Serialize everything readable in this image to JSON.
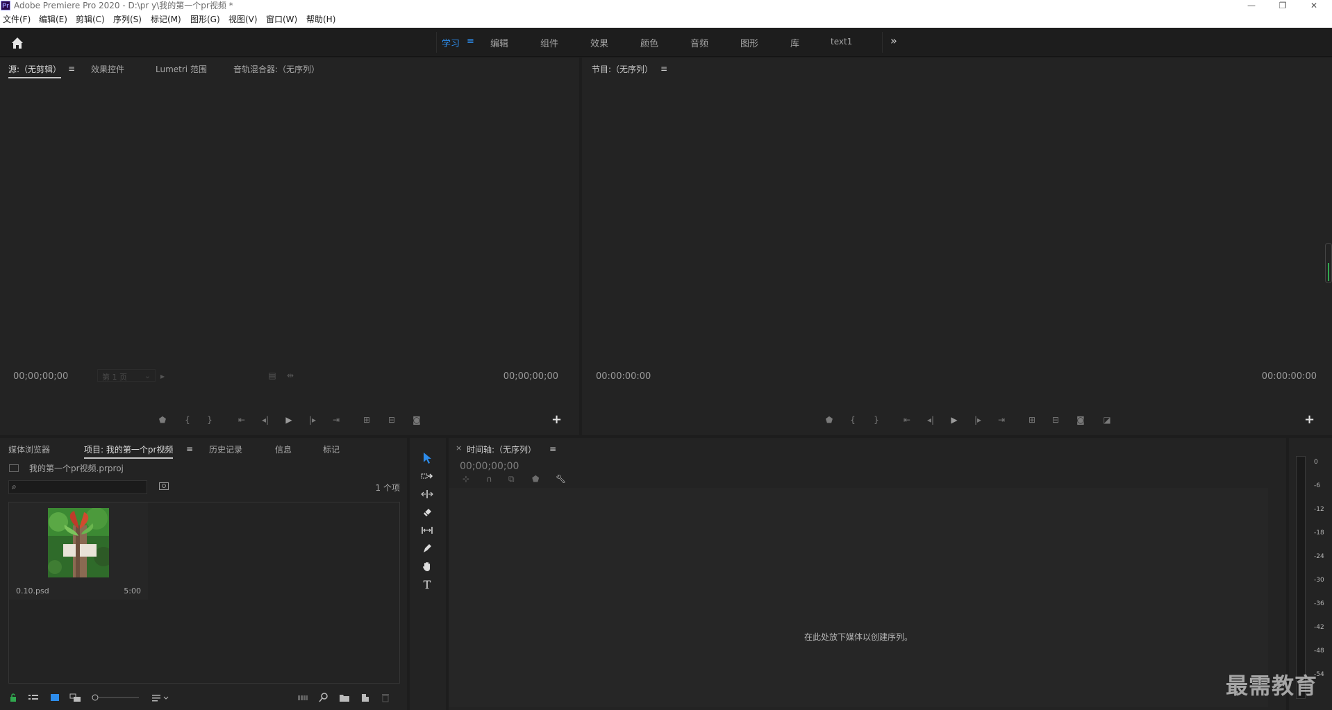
{
  "window": {
    "title": "Adobe Premiere Pro 2020 - D:\\pr y\\我的第一个pr视频 *",
    "app_icon_text": "Pr",
    "controls": [
      "—",
      "❐",
      "✕"
    ]
  },
  "menu": [
    "文件(F)",
    "编辑(E)",
    "剪辑(C)",
    "序列(S)",
    "标记(M)",
    "图形(G)",
    "视图(V)",
    "窗口(W)",
    "帮助(H)"
  ],
  "workspaces": {
    "tabs": [
      "学习",
      "编辑",
      "组件",
      "效果",
      "颜色",
      "音频",
      "图形",
      "库",
      "text1"
    ],
    "active_index": 0,
    "menu_glyph": "≡",
    "more_glyph": "»"
  },
  "source_panel": {
    "tabs": [
      "源:（无剪辑）",
      "效果控件",
      "Lumetri 范围",
      "音轨混合器:（无序列）"
    ],
    "menu_glyph": "≡",
    "timecode_left": "00;00;00;00",
    "page_select": "第 1 页",
    "timecode_right": "00;00;00;00"
  },
  "program_panel": {
    "tab": "节目:（无序列）",
    "menu_glyph": "≡",
    "timecode_left": "00:00:00:00",
    "timecode_right": "00:00:00:00"
  },
  "project_panel": {
    "tabs": [
      "媒体浏览器",
      "项目: 我的第一个pr视频",
      "历史记录",
      "信息",
      "标记"
    ],
    "active_index": 1,
    "menu_glyph": "≡",
    "project_file": "我的第一个pr视频.prproj",
    "search_placeholder": "",
    "item_count": "1 个项",
    "clips": [
      {
        "name": "0.10.psd",
        "duration": "5:00"
      }
    ]
  },
  "timeline_panel": {
    "close_glyph": "×",
    "tab": "时间轴:（无序列）",
    "menu_glyph": "≡",
    "timecode": "00;00;00;00",
    "empty_message": "在此处放下媒体以创建序列。"
  },
  "audio_meter": {
    "db_labels": [
      "0",
      "-6",
      "-12",
      "-18",
      "-24",
      "-30",
      "-36",
      "-42",
      "-48",
      "-54"
    ]
  },
  "watermark": "最需教育",
  "colors": {
    "accent": "#2d8ceb",
    "panel_bg": "#232323",
    "app_bg": "#1d1d1d",
    "meter_green": "#31a84f"
  }
}
